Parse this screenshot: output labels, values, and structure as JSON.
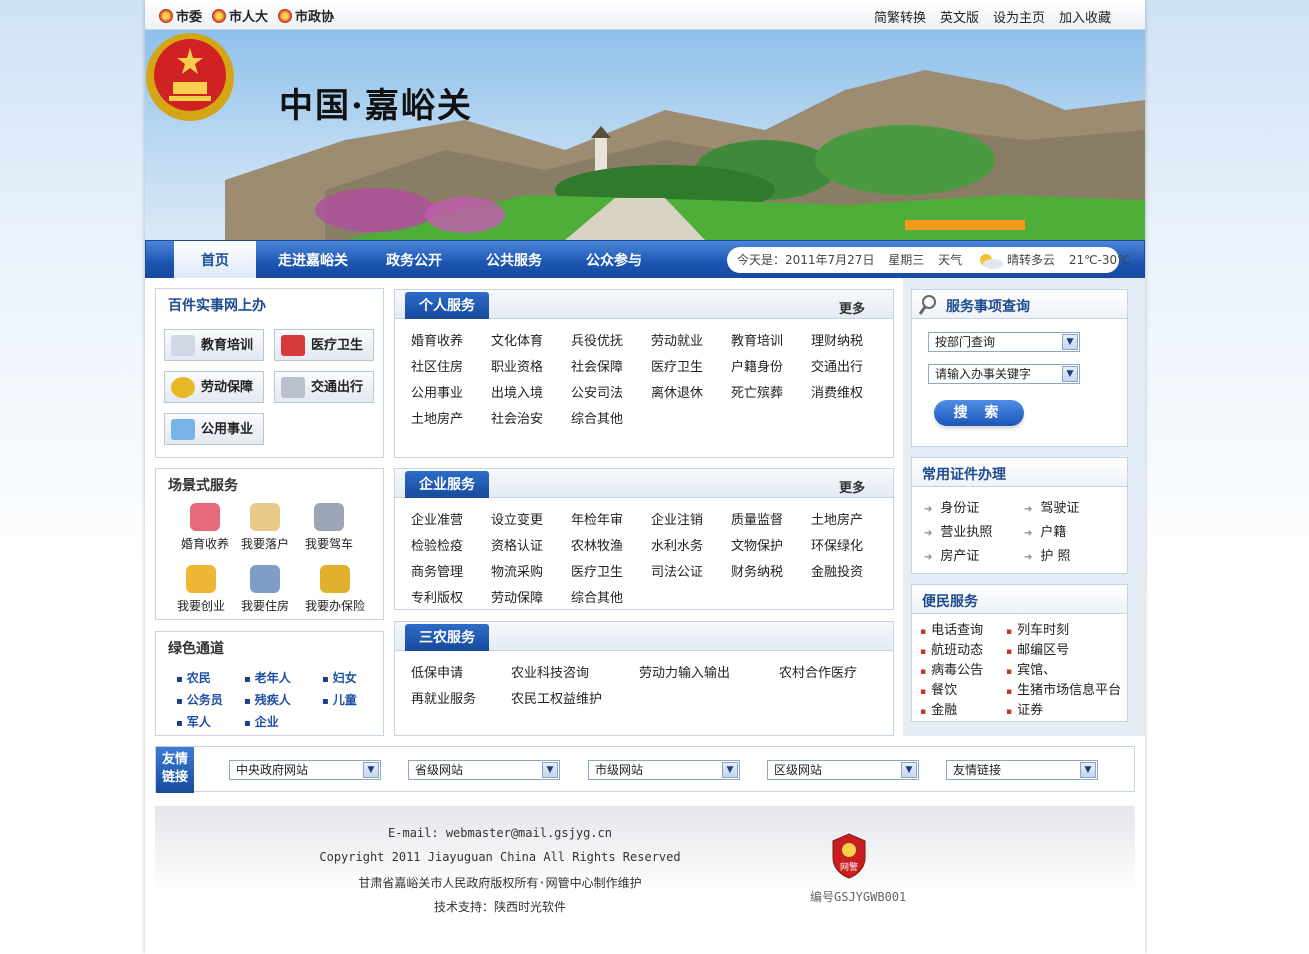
{
  "topbar": {
    "left_links": [
      "市委",
      "市人大",
      "市政协"
    ],
    "right_links": [
      "简繁转换",
      "英文版",
      "设为主页",
      "加入收藏"
    ]
  },
  "banner": {
    "title": "中国·嘉峪关"
  },
  "nav": {
    "items": [
      "首页",
      "走进嘉峪关",
      "政务公开",
      "公共服务",
      "公众参与"
    ],
    "active": "首页"
  },
  "weather": {
    "today": "今天是：2011年7月27日",
    "weekday": "星期三",
    "label": "天气",
    "condition": "晴转多云",
    "temp": "21℃-30℃"
  },
  "left": {
    "online_title": "百件实事网上办",
    "online_buttons": [
      "教育培训",
      "医疗卫生",
      "劳动保障",
      "交通出行",
      "公用事业"
    ],
    "scene_title": "场景式服务",
    "scene_items": [
      "婚育收养",
      "我要落户",
      "我要驾车",
      "我要创业",
      "我要住房",
      "我要办保险"
    ],
    "green_title": "绿色通道",
    "green_items": [
      "农民",
      "老年人",
      "妇女",
      "公务员",
      "残疾人",
      "儿童",
      "军人",
      "企业"
    ]
  },
  "center": {
    "personal": {
      "title": "个人服务",
      "more": "更多",
      "links": [
        "婚育收养",
        "文化体育",
        "兵役优抚",
        "劳动就业",
        "教育培训",
        "理财纳税",
        "社区住房",
        "职业资格",
        "社会保障",
        "医疗卫生",
        "户籍身份",
        "交通出行",
        "公用事业",
        "出境入境",
        "公安司法",
        "离休退休",
        "死亡殡葬",
        "消费维权",
        "土地房产",
        "社会治安",
        "综合其他"
      ]
    },
    "enterprise": {
      "title": "企业服务",
      "more": "更多",
      "links": [
        "企业准营",
        "设立变更",
        "年检年审",
        "企业注销",
        "质量监督",
        "土地房产",
        "检验检疫",
        "资格认证",
        "农林牧渔",
        "水利水务",
        "文物保护",
        "环保绿化",
        "商务管理",
        "物流采购",
        "医疗卫生",
        "司法公证",
        "财务纳税",
        "金融投资",
        "专利版权",
        "劳动保障",
        "综合其他"
      ]
    },
    "agri": {
      "title": "三农服务",
      "links": [
        "低保申请",
        "农业科技咨询",
        "劳动力输入输出",
        "农村合作医疗",
        "再就业服务",
        "农民工权益维护"
      ]
    }
  },
  "right": {
    "query_title": "服务事项查询",
    "dept_select": "按部门查询",
    "keyword_select": "请输入办事关键字",
    "search_button": "搜 索",
    "cert_title": "常用证件办理",
    "cert_items": [
      "身份证",
      "驾驶证",
      "营业执照",
      "户籍",
      "房产证",
      "护 照"
    ],
    "conv_title": "便民服务",
    "conv_items": [
      "电话查询",
      "列车时刻",
      "航班动态",
      "邮编区号",
      "病毒公告",
      "宾馆、",
      "餐饮",
      "生猪市场信息平台",
      "金融",
      "证券"
    ]
  },
  "friend": {
    "tag_line1": "友情",
    "tag_line2": "链接",
    "selects": [
      "中央政府网站",
      "省级网站",
      "市级网站",
      "区级网站",
      "友情链接"
    ]
  },
  "footer": {
    "email": "E-mail: webmaster@mail.gsjyg.cn",
    "copyright": "Copyright 2011 Jiayuguan China All Rights Reserved",
    "owner": "甘肃省嘉峪关市人民政府版权所有·网管中心制作维护",
    "support": "技术支持：陕西时光软件",
    "badge_label": "网警",
    "badge_no": "编号GSJYGWB001"
  },
  "colors": {
    "nav_blue": "#1c56b3",
    "title_blue": "#1e4a8e",
    "accent_red": "#c81e1e"
  }
}
